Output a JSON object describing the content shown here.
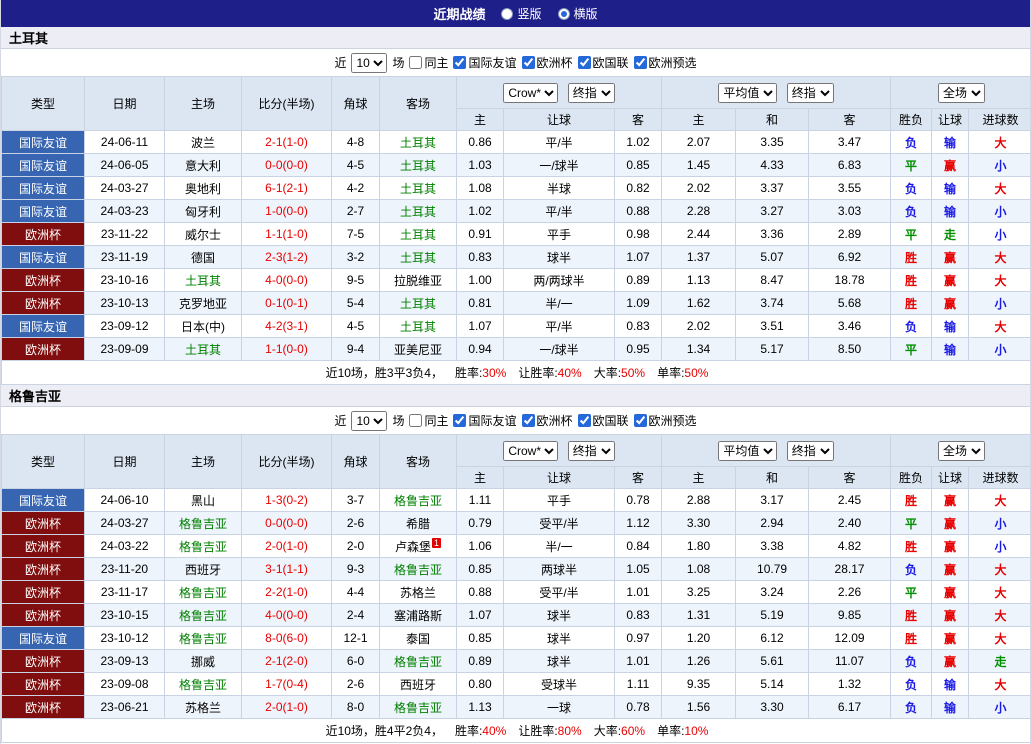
{
  "topbar": {
    "title": "近期战绩",
    "radios": [
      {
        "label": "竖版",
        "selected": false
      },
      {
        "label": "横版",
        "selected": true
      }
    ]
  },
  "filter": {
    "near_label": "近",
    "count_value": "10",
    "games_label": "场",
    "checkboxes": [
      {
        "label": "同主",
        "checked": false
      },
      {
        "label": "国际友谊",
        "checked": true
      },
      {
        "label": "欧洲杯",
        "checked": true
      },
      {
        "label": "欧国联",
        "checked": true
      },
      {
        "label": "欧洲预选",
        "checked": true
      }
    ]
  },
  "table": {
    "columns": {
      "type": "类型",
      "date": "日期",
      "home": "主场",
      "score": "比分(半场)",
      "corner": "角球",
      "away": "客场"
    },
    "selects": {
      "bookmaker": "Crow*",
      "bookmaker_final": "终指",
      "average": "平均值",
      "average_final": "终指",
      "scope": "全场"
    },
    "subcolumns": {
      "odds_home": "主",
      "odds_handicap": "让球",
      "odds_away": "客",
      "avg_home": "主",
      "avg_draw": "和",
      "avg_away": "客",
      "result": "胜负",
      "handicap_result": "让球",
      "goals_result": "进球数"
    }
  },
  "colors": {
    "win_red": "#e80000",
    "draw_green": "#009000",
    "loss_blue": "#1a1ae6",
    "friendly_bg": "#3765b2",
    "euro_bg": "#800e0e",
    "team_green": "#008000",
    "topbar_bg": "#1f1f8a"
  },
  "sections": [
    {
      "team": "土耳其",
      "rows": [
        {
          "type": "国际友谊",
          "type_class": "friendly",
          "date": "24-06-11",
          "home": "波兰",
          "home_team": false,
          "score": "2-1(1-0)",
          "corner": "4-8",
          "away": "土耳其",
          "away_team": true,
          "crown": [
            "0.86",
            "平/半",
            "1.02"
          ],
          "avg": [
            "2.07",
            "3.35",
            "3.47"
          ],
          "results": [
            {
              "t": "负",
              "c": "blue"
            },
            {
              "t": "输",
              "c": "blue"
            },
            {
              "t": "大",
              "c": "red"
            }
          ]
        },
        {
          "type": "国际友谊",
          "type_class": "friendly",
          "date": "24-06-05",
          "home": "意大利",
          "home_team": false,
          "score": "0-0(0-0)",
          "corner": "4-5",
          "away": "土耳其",
          "away_team": true,
          "crown": [
            "1.03",
            "一/球半",
            "0.85"
          ],
          "avg": [
            "1.45",
            "4.33",
            "6.83"
          ],
          "results": [
            {
              "t": "平",
              "c": "green"
            },
            {
              "t": "赢",
              "c": "red"
            },
            {
              "t": "小",
              "c": "blue"
            }
          ]
        },
        {
          "type": "国际友谊",
          "type_class": "friendly",
          "date": "24-03-27",
          "home": "奥地利",
          "home_team": false,
          "score": "6-1(2-1)",
          "corner": "4-2",
          "away": "土耳其",
          "away_team": true,
          "crown": [
            "1.08",
            "半球",
            "0.82"
          ],
          "avg": [
            "2.02",
            "3.37",
            "3.55"
          ],
          "results": [
            {
              "t": "负",
              "c": "blue"
            },
            {
              "t": "输",
              "c": "blue"
            },
            {
              "t": "大",
              "c": "red"
            }
          ]
        },
        {
          "type": "国际友谊",
          "type_class": "friendly",
          "date": "24-03-23",
          "home": "匈牙利",
          "home_team": false,
          "score": "1-0(0-0)",
          "corner": "2-7",
          "away": "土耳其",
          "away_team": true,
          "crown": [
            "1.02",
            "平/半",
            "0.88"
          ],
          "avg": [
            "2.28",
            "3.27",
            "3.03"
          ],
          "results": [
            {
              "t": "负",
              "c": "blue"
            },
            {
              "t": "输",
              "c": "blue"
            },
            {
              "t": "小",
              "c": "blue"
            }
          ]
        },
        {
          "type": "欧洲杯",
          "type_class": "euro",
          "date": "23-11-22",
          "home": "威尔士",
          "home_team": false,
          "score": "1-1(1-0)",
          "corner": "7-5",
          "away": "土耳其",
          "away_team": true,
          "crown": [
            "0.91",
            "平手",
            "0.98"
          ],
          "avg": [
            "2.44",
            "3.36",
            "2.89"
          ],
          "results": [
            {
              "t": "平",
              "c": "green"
            },
            {
              "t": "走",
              "c": "green"
            },
            {
              "t": "小",
              "c": "blue"
            }
          ]
        },
        {
          "type": "国际友谊",
          "type_class": "friendly",
          "date": "23-11-19",
          "home": "德国",
          "home_team": false,
          "score": "2-3(1-2)",
          "corner": "3-2",
          "away": "土耳其",
          "away_team": true,
          "crown": [
            "0.83",
            "球半",
            "1.07"
          ],
          "avg": [
            "1.37",
            "5.07",
            "6.92"
          ],
          "results": [
            {
              "t": "胜",
              "c": "red"
            },
            {
              "t": "赢",
              "c": "red"
            },
            {
              "t": "大",
              "c": "red"
            }
          ]
        },
        {
          "type": "欧洲杯",
          "type_class": "euro",
          "date": "23-10-16",
          "home": "土耳其",
          "home_team": true,
          "score": "4-0(0-0)",
          "corner": "9-5",
          "away": "拉脱维亚",
          "away_team": false,
          "crown": [
            "1.00",
            "两/两球半",
            "0.89"
          ],
          "avg": [
            "1.13",
            "8.47",
            "18.78"
          ],
          "results": [
            {
              "t": "胜",
              "c": "red"
            },
            {
              "t": "赢",
              "c": "red"
            },
            {
              "t": "大",
              "c": "red"
            }
          ]
        },
        {
          "type": "欧洲杯",
          "type_class": "euro",
          "date": "23-10-13",
          "home": "克罗地亚",
          "home_team": false,
          "score": "0-1(0-1)",
          "corner": "5-4",
          "away": "土耳其",
          "away_team": true,
          "crown": [
            "0.81",
            "半/一",
            "1.09"
          ],
          "avg": [
            "1.62",
            "3.74",
            "5.68"
          ],
          "results": [
            {
              "t": "胜",
              "c": "red"
            },
            {
              "t": "赢",
              "c": "red"
            },
            {
              "t": "小",
              "c": "blue"
            }
          ]
        },
        {
          "type": "国际友谊",
          "type_class": "friendly",
          "date": "23-09-12",
          "home": "日本(中)",
          "home_team": false,
          "score": "4-2(3-1)",
          "corner": "4-5",
          "away": "土耳其",
          "away_team": true,
          "crown": [
            "1.07",
            "平/半",
            "0.83"
          ],
          "avg": [
            "2.02",
            "3.51",
            "3.46"
          ],
          "results": [
            {
              "t": "负",
              "c": "blue"
            },
            {
              "t": "输",
              "c": "blue"
            },
            {
              "t": "大",
              "c": "red"
            }
          ]
        },
        {
          "type": "欧洲杯",
          "type_class": "euro",
          "date": "23-09-09",
          "home": "土耳其",
          "home_team": true,
          "score": "1-1(0-0)",
          "corner": "9-4",
          "away": "亚美尼亚",
          "away_team": false,
          "crown": [
            "0.94",
            "一/球半",
            "0.95"
          ],
          "avg": [
            "1.34",
            "5.17",
            "8.50"
          ],
          "results": [
            {
              "t": "平",
              "c": "green"
            },
            {
              "t": "输",
              "c": "blue"
            },
            {
              "t": "小",
              "c": "blue"
            }
          ]
        }
      ],
      "summary": {
        "prefix": "近10场，胜3平3负4，",
        "stats": [
          {
            "label": "胜率:",
            "value": "30%"
          },
          {
            "label": "让胜率:",
            "value": "40%"
          },
          {
            "label": "大率:",
            "value": "50%"
          },
          {
            "label": "单率:",
            "value": "50%"
          }
        ]
      }
    },
    {
      "team": "格鲁吉亚",
      "rows": [
        {
          "type": "国际友谊",
          "type_class": "friendly",
          "date": "24-06-10",
          "home": "黑山",
          "home_team": false,
          "score": "1-3(0-2)",
          "corner": "3-7",
          "away": "格鲁吉亚",
          "away_team": true,
          "crown": [
            "1.11",
            "平手",
            "0.78"
          ],
          "avg": [
            "2.88",
            "3.17",
            "2.45"
          ],
          "results": [
            {
              "t": "胜",
              "c": "red"
            },
            {
              "t": "赢",
              "c": "red"
            },
            {
              "t": "大",
              "c": "red"
            }
          ]
        },
        {
          "type": "欧洲杯",
          "type_class": "euro",
          "date": "24-03-27",
          "home": "格鲁吉亚",
          "home_team": true,
          "score": "0-0(0-0)",
          "corner": "2-6",
          "away": "希腊",
          "away_team": false,
          "crown": [
            "0.79",
            "受平/半",
            "1.12"
          ],
          "avg": [
            "3.30",
            "2.94",
            "2.40"
          ],
          "results": [
            {
              "t": "平",
              "c": "green"
            },
            {
              "t": "赢",
              "c": "red"
            },
            {
              "t": "小",
              "c": "blue"
            }
          ]
        },
        {
          "type": "欧洲杯",
          "type_class": "euro",
          "date": "24-03-22",
          "home": "格鲁吉亚",
          "home_team": true,
          "score": "2-0(1-0)",
          "corner": "2-0",
          "away": "卢森堡",
          "away_team": false,
          "away_badge": "1",
          "crown": [
            "1.06",
            "半/一",
            "0.84"
          ],
          "avg": [
            "1.80",
            "3.38",
            "4.82"
          ],
          "results": [
            {
              "t": "胜",
              "c": "red"
            },
            {
              "t": "赢",
              "c": "red"
            },
            {
              "t": "小",
              "c": "blue"
            }
          ]
        },
        {
          "type": "欧洲杯",
          "type_class": "euro",
          "date": "23-11-20",
          "home": "西班牙",
          "home_team": false,
          "score": "3-1(1-1)",
          "corner": "9-3",
          "away": "格鲁吉亚",
          "away_team": true,
          "crown": [
            "0.85",
            "两球半",
            "1.05"
          ],
          "avg": [
            "1.08",
            "10.79",
            "28.17"
          ],
          "results": [
            {
              "t": "负",
              "c": "blue"
            },
            {
              "t": "赢",
              "c": "red"
            },
            {
              "t": "大",
              "c": "red"
            }
          ]
        },
        {
          "type": "欧洲杯",
          "type_class": "euro",
          "date": "23-11-17",
          "home": "格鲁吉亚",
          "home_team": true,
          "score": "2-2(1-0)",
          "corner": "4-4",
          "away": "苏格兰",
          "away_team": false,
          "crown": [
            "0.88",
            "受平/半",
            "1.01"
          ],
          "avg": [
            "3.25",
            "3.24",
            "2.26"
          ],
          "results": [
            {
              "t": "平",
              "c": "green"
            },
            {
              "t": "赢",
              "c": "red"
            },
            {
              "t": "大",
              "c": "red"
            }
          ]
        },
        {
          "type": "欧洲杯",
          "type_class": "euro",
          "date": "23-10-15",
          "home": "格鲁吉亚",
          "home_team": true,
          "score": "4-0(0-0)",
          "corner": "2-4",
          "away": "塞浦路斯",
          "away_team": false,
          "crown": [
            "1.07",
            "球半",
            "0.83"
          ],
          "avg": [
            "1.31",
            "5.19",
            "9.85"
          ],
          "results": [
            {
              "t": "胜",
              "c": "red"
            },
            {
              "t": "赢",
              "c": "red"
            },
            {
              "t": "大",
              "c": "red"
            }
          ]
        },
        {
          "type": "国际友谊",
          "type_class": "friendly",
          "date": "23-10-12",
          "home": "格鲁吉亚",
          "home_team": true,
          "score": "8-0(6-0)",
          "corner": "12-1",
          "away": "泰国",
          "away_team": false,
          "crown": [
            "0.85",
            "球半",
            "0.97"
          ],
          "avg": [
            "1.20",
            "6.12",
            "12.09"
          ],
          "results": [
            {
              "t": "胜",
              "c": "red"
            },
            {
              "t": "赢",
              "c": "red"
            },
            {
              "t": "大",
              "c": "red"
            }
          ]
        },
        {
          "type": "欧洲杯",
          "type_class": "euro",
          "date": "23-09-13",
          "home": "挪威",
          "home_team": false,
          "score": "2-1(2-0)",
          "corner": "6-0",
          "away": "格鲁吉亚",
          "away_team": true,
          "crown": [
            "0.89",
            "球半",
            "1.01"
          ],
          "avg": [
            "1.26",
            "5.61",
            "11.07"
          ],
          "results": [
            {
              "t": "负",
              "c": "blue"
            },
            {
              "t": "赢",
              "c": "red"
            },
            {
              "t": "走",
              "c": "green"
            }
          ]
        },
        {
          "type": "欧洲杯",
          "type_class": "euro",
          "date": "23-09-08",
          "home": "格鲁吉亚",
          "home_team": true,
          "score": "1-7(0-4)",
          "corner": "2-6",
          "away": "西班牙",
          "away_team": false,
          "crown": [
            "0.80",
            "受球半",
            "1.11"
          ],
          "avg": [
            "9.35",
            "5.14",
            "1.32"
          ],
          "results": [
            {
              "t": "负",
              "c": "blue"
            },
            {
              "t": "输",
              "c": "blue"
            },
            {
              "t": "大",
              "c": "red"
            }
          ]
        },
        {
          "type": "欧洲杯",
          "type_class": "euro",
          "date": "23-06-21",
          "home": "苏格兰",
          "home_team": false,
          "score": "2-0(1-0)",
          "corner": "8-0",
          "away": "格鲁吉亚",
          "away_team": true,
          "crown": [
            "1.13",
            "一球",
            "0.78"
          ],
          "avg": [
            "1.56",
            "3.30",
            "6.17"
          ],
          "results": [
            {
              "t": "负",
              "c": "blue"
            },
            {
              "t": "输",
              "c": "blue"
            },
            {
              "t": "小",
              "c": "blue"
            }
          ]
        }
      ],
      "summary": {
        "prefix": "近10场，胜4平2负4，",
        "stats": [
          {
            "label": "胜率:",
            "value": "40%"
          },
          {
            "label": "让胜率:",
            "value": "80%"
          },
          {
            "label": "大率:",
            "value": "60%"
          },
          {
            "label": "单率:",
            "value": "10%"
          }
        ]
      }
    }
  ]
}
